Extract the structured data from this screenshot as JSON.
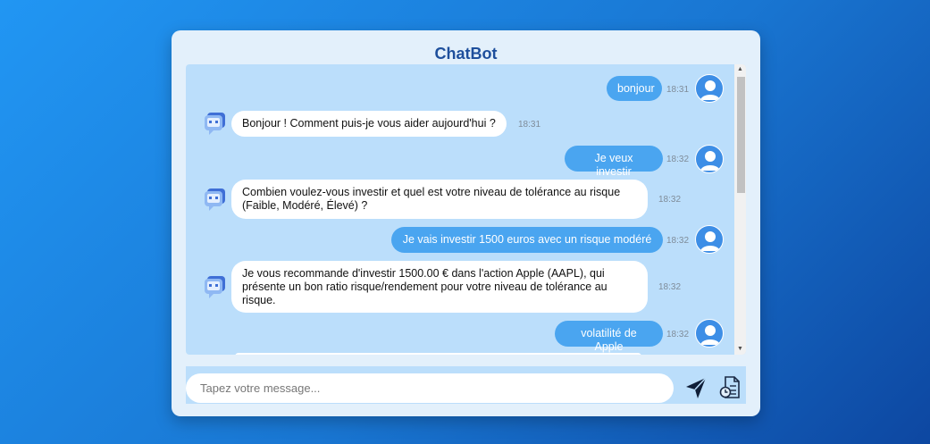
{
  "app": {
    "title": "ChatBot"
  },
  "messages": [
    {
      "sender": "user",
      "text": "bonjour",
      "time": "18:31"
    },
    {
      "sender": "bot",
      "text": "Bonjour ! Comment puis-je vous aider aujourd'hui ?",
      "time": "18:31"
    },
    {
      "sender": "user",
      "text": "Je veux investir",
      "time": "18:32"
    },
    {
      "sender": "bot",
      "text": "Combien voulez-vous investir et quel est votre niveau de tolérance au risque (Faible, Modéré, Élevé) ?",
      "time": "18:32"
    },
    {
      "sender": "user",
      "text": "Je vais investir 1500 euros avec un risque modéré",
      "time": "18:32"
    },
    {
      "sender": "bot",
      "text": "Je vous recommande d'investir 1500.00 € dans l'action Apple (AAPL), qui présente un bon ratio risque/rendement pour votre niveau de tolérance au risque.",
      "time": "18:32"
    },
    {
      "sender": "user",
      "text": "volatilité de Apple",
      "time": "18:32"
    }
  ],
  "input": {
    "placeholder": "Tapez votre message..."
  },
  "icons": {
    "send": "send-paper-plane-icon",
    "file": "file-clock-icon",
    "user_avatar": "user-avatar-icon",
    "bot_avatar": "robot-chat-icon"
  },
  "colors": {
    "accent": "#4aa5f0",
    "title": "#1e4f9c",
    "chat_bg": "#bbdefb"
  }
}
